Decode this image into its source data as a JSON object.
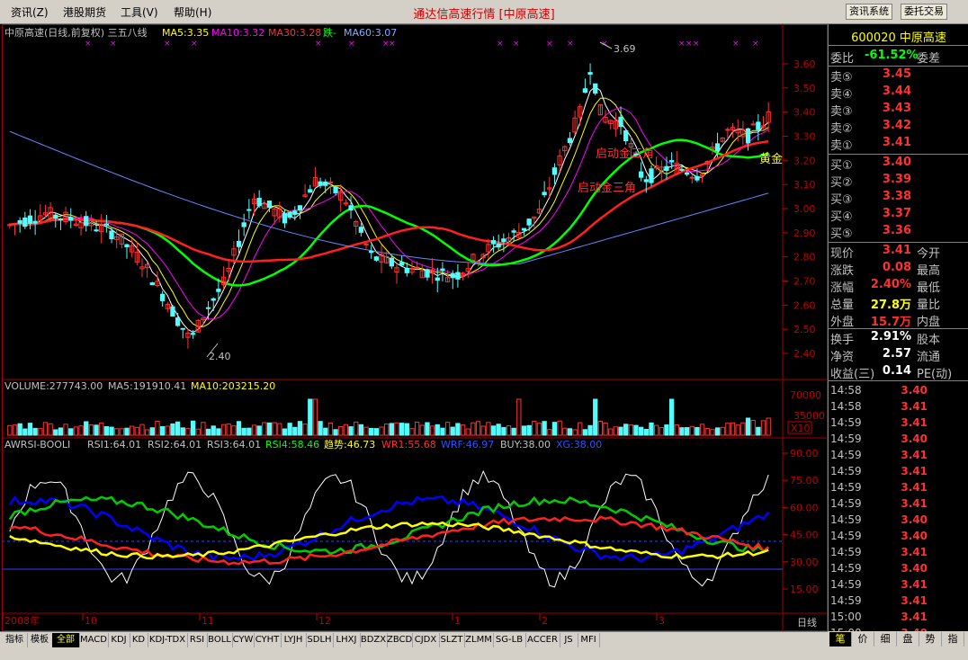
{
  "menu": {
    "items": [
      "资讯(Z)",
      "港股期货",
      "工具(V)",
      "帮助(H)"
    ],
    "title": "通达信高速行情 [中原高速]",
    "btn_news": "资讯系统",
    "btn_trade": "委托交易"
  },
  "chart": {
    "header": {
      "name": "中原高速(日线,前复权) 三五八线",
      "ma5": "MA5:3.35",
      "ma10": "MA10:3.32",
      "ma30": "MA30:3.28",
      "fall": "跌-",
      "ma60": "MA60:3.07"
    },
    "price_ticks": [
      "3.60",
      "3.50",
      "3.40",
      "3.30",
      "3.20",
      "3.10",
      "3.00",
      "2.90",
      "2.80",
      "2.70",
      "2.60",
      "2.50",
      "2.40"
    ],
    "high_label": "3.69",
    "low_label": "2.40",
    "ann_1": "启动金三角",
    "ann_2": "启动金三角",
    "ann_3": "黄金",
    "volume": {
      "label": "VOLUME:277743.00",
      "ma5": "MA5:191910.41",
      "ma10": "MA10:203215.20",
      "ticks": [
        "70000",
        "35000"
      ],
      "x10": "X10"
    },
    "awrsi": {
      "label": "AWRSI-BOOLI",
      "rsi1": "RSI1:64.01",
      "rsi2": "RSI2:64.01",
      "rsi3": "RSI3:64.01",
      "rsi4": "RSI4:58.46",
      "trend": "趋势:46.73",
      "wr1": "WR1:55.68",
      "wrf": "WRF:46.97",
      "buy": "BUY:38.00",
      "xg": "XG:38.00",
      "ticks": [
        "90.00",
        "75.00",
        "60.00",
        "45.00",
        "30.00",
        "15.00"
      ]
    },
    "xaxis": {
      "labels": [
        "2008年",
        "10",
        "11",
        "12",
        "1",
        "2",
        "3"
      ],
      "period": "日线"
    },
    "colors": {
      "up": "#ff3232",
      "down": "#54fcfc",
      "ma5": "#ffffff",
      "ma10": "#ffff00",
      "ma30": "#ff00ff",
      "ma60": "#00ff00",
      "ma_blue": "#6688ff"
    }
  },
  "bottom_tabs": [
    "指标",
    "模板",
    "全部",
    "MACD",
    "KDJ",
    "KD",
    "KDJ-TDX",
    "RSI",
    "BOLL",
    "CYW",
    "CYHT",
    "LYJH",
    "SDLH",
    "LHXJ",
    "BDZX",
    "ZBCD",
    "CJDX",
    "SLZT",
    "ZLMM",
    "SG-LB",
    "ACCER",
    "JS",
    "MFI"
  ],
  "right": {
    "title": "600020 中原高速",
    "weibi": {
      "label": "委比",
      "value": "-61.52%",
      "label2": "委差"
    },
    "sell": [
      {
        "label": "卖⑤",
        "price": "3.45"
      },
      {
        "label": "卖④",
        "price": "3.44"
      },
      {
        "label": "卖③",
        "price": "3.43"
      },
      {
        "label": "卖②",
        "price": "3.42"
      },
      {
        "label": "卖①",
        "price": "3.41"
      }
    ],
    "buy": [
      {
        "label": "买①",
        "price": "3.40"
      },
      {
        "label": "买②",
        "price": "3.39"
      },
      {
        "label": "买③",
        "price": "3.38"
      },
      {
        "label": "买④",
        "price": "3.37"
      },
      {
        "label": "买⑤",
        "price": "3.36"
      }
    ],
    "stats": [
      {
        "label": "现价",
        "value": "3.41",
        "label2": "今开",
        "color": "#ff3030"
      },
      {
        "label": "涨跌",
        "value": "0.08",
        "label2": "最高",
        "color": "#ff3030"
      },
      {
        "label": "涨幅",
        "value": "2.40%",
        "label2": "最低",
        "color": "#ff3030"
      },
      {
        "label": "总量",
        "value": "27.8万",
        "label2": "量比",
        "color": "#ffff00"
      },
      {
        "label": "外盘",
        "value": "15.7万",
        "label2": "内盘",
        "color": "#ff3030"
      }
    ],
    "stats2": [
      {
        "label": "换手",
        "value": "2.91%",
        "label2": "股本"
      },
      {
        "label": "净资",
        "value": "2.57",
        "label2": "流通"
      },
      {
        "label": "收益(三)",
        "value": "0.14",
        "label2": "PE(动)"
      }
    ],
    "trades": [
      {
        "time": "14:58",
        "price": "3.40"
      },
      {
        "time": "14:58",
        "price": "3.41"
      },
      {
        "time": "14:59",
        "price": "3.41"
      },
      {
        "time": "14:59",
        "price": "3.40"
      },
      {
        "time": "14:59",
        "price": "3.41"
      },
      {
        "time": "14:59",
        "price": "3.41"
      },
      {
        "time": "14:59",
        "price": "3.41"
      },
      {
        "time": "14:59",
        "price": "3.41"
      },
      {
        "time": "14:59",
        "price": "3.40"
      },
      {
        "time": "14:59",
        "price": "3.40"
      },
      {
        "time": "14:59",
        "price": "3.41"
      },
      {
        "time": "14:59",
        "price": "3.40"
      },
      {
        "time": "14:59",
        "price": "3.41"
      },
      {
        "time": "14:59",
        "price": "3.41"
      },
      {
        "time": "15:00",
        "price": "3.41"
      },
      {
        "time": "15:00",
        "price": "3.40"
      }
    ],
    "tabs": [
      "笔",
      "价",
      "细",
      "盘",
      "势",
      "指"
    ]
  }
}
